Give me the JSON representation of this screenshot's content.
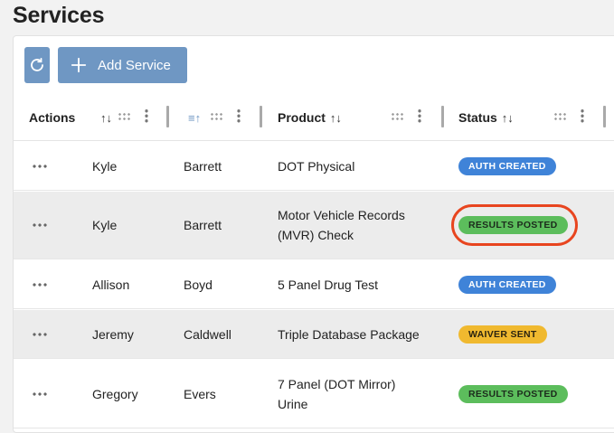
{
  "page": {
    "title": "Services"
  },
  "toolbar": {
    "add_label": "Add Service"
  },
  "columns": [
    {
      "label": "Actions"
    },
    {
      "label": ""
    },
    {
      "label": ""
    },
    {
      "label": "Product"
    },
    {
      "label": "Status"
    }
  ],
  "sort_glyphs": {
    "neutral": "↑↓",
    "asc": "≡↑"
  },
  "rows": [
    {
      "first": "Kyle",
      "last": "Barrett",
      "product_1": "DOT Physical",
      "product_2": "",
      "status": "AUTH CREATED",
      "status_color": "blue"
    },
    {
      "first": "Kyle",
      "last": "Barrett",
      "product_1": "Motor Vehicle Records",
      "product_2": "(MVR) Check",
      "status": "RESULTS POSTED",
      "status_color": "green"
    },
    {
      "first": "Allison",
      "last": "Boyd",
      "product_1": "5 Panel Drug Test",
      "product_2": "",
      "status": "AUTH CREATED",
      "status_color": "blue"
    },
    {
      "first": "Jeremy",
      "last": "Caldwell",
      "product_1": "Triple Database Package",
      "product_2": "",
      "status": "WAIVER SENT",
      "status_color": "yellow"
    },
    {
      "first": "Gregory",
      "last": "Evers",
      "product_1": "7 Panel (DOT Mirror)",
      "product_2": "Urine",
      "status": "RESULTS POSTED",
      "status_color": "green"
    }
  ],
  "colors": {
    "button": "#6f97c3",
    "blue": "#3f83d8",
    "green": "#5cbd5c",
    "yellow": "#f0b92f",
    "highlight": "#e8451f"
  }
}
